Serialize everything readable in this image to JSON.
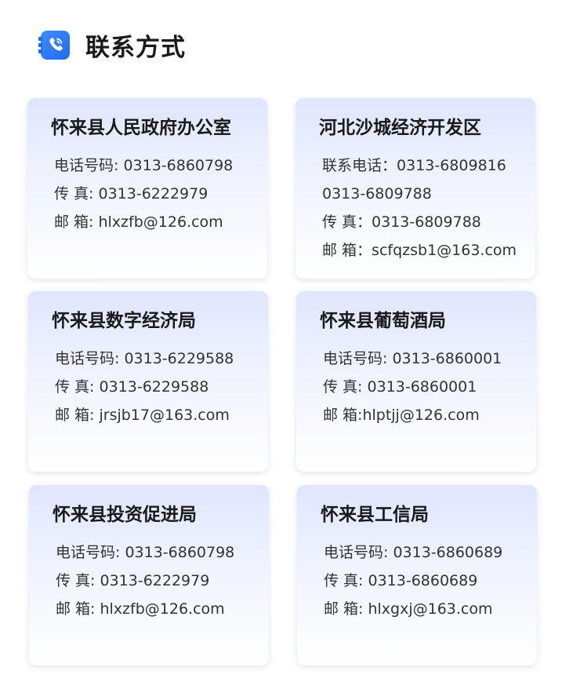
{
  "header": {
    "title": "联系方式",
    "icon": "phone-book-icon",
    "icon_color": "#2a7bf7"
  },
  "cards": [
    {
      "title": "怀来县人民政府办公室",
      "lines": [
        "电话号码: 0313-6860798",
        "传 真: 0313-6222979",
        "邮 箱: hlxzfb@126.com"
      ]
    },
    {
      "title": "河北沙城经济开发区",
      "lines": [
        "联系电话：0313-6809816",
        "0313-6809788",
        "传 真：0313-6809788",
        "邮 箱：scfqzsb1@163.com"
      ]
    },
    {
      "title": "怀来县数字经济局",
      "lines": [
        "电话号码: 0313-6229588",
        "传 真: 0313-6229588",
        "邮 箱: jrsjb17@163.com"
      ]
    },
    {
      "title": "怀来县葡萄酒局",
      "lines": [
        "电话号码: 0313-6860001",
        "传 真: 0313-6860001",
        "邮 箱:hlptjj@126.com"
      ]
    },
    {
      "title": "怀来县投资促进局",
      "lines": [
        "电话号码: 0313-6860798",
        "传 真: 0313-6222979",
        "邮 箱: hlxzfb@126.com"
      ]
    },
    {
      "title": "怀来县工信局",
      "lines": [
        "电话号码: 0313-6860689",
        "传 真: 0313-6860689",
        "邮 箱: hlxgxj@163.com"
      ]
    }
  ]
}
